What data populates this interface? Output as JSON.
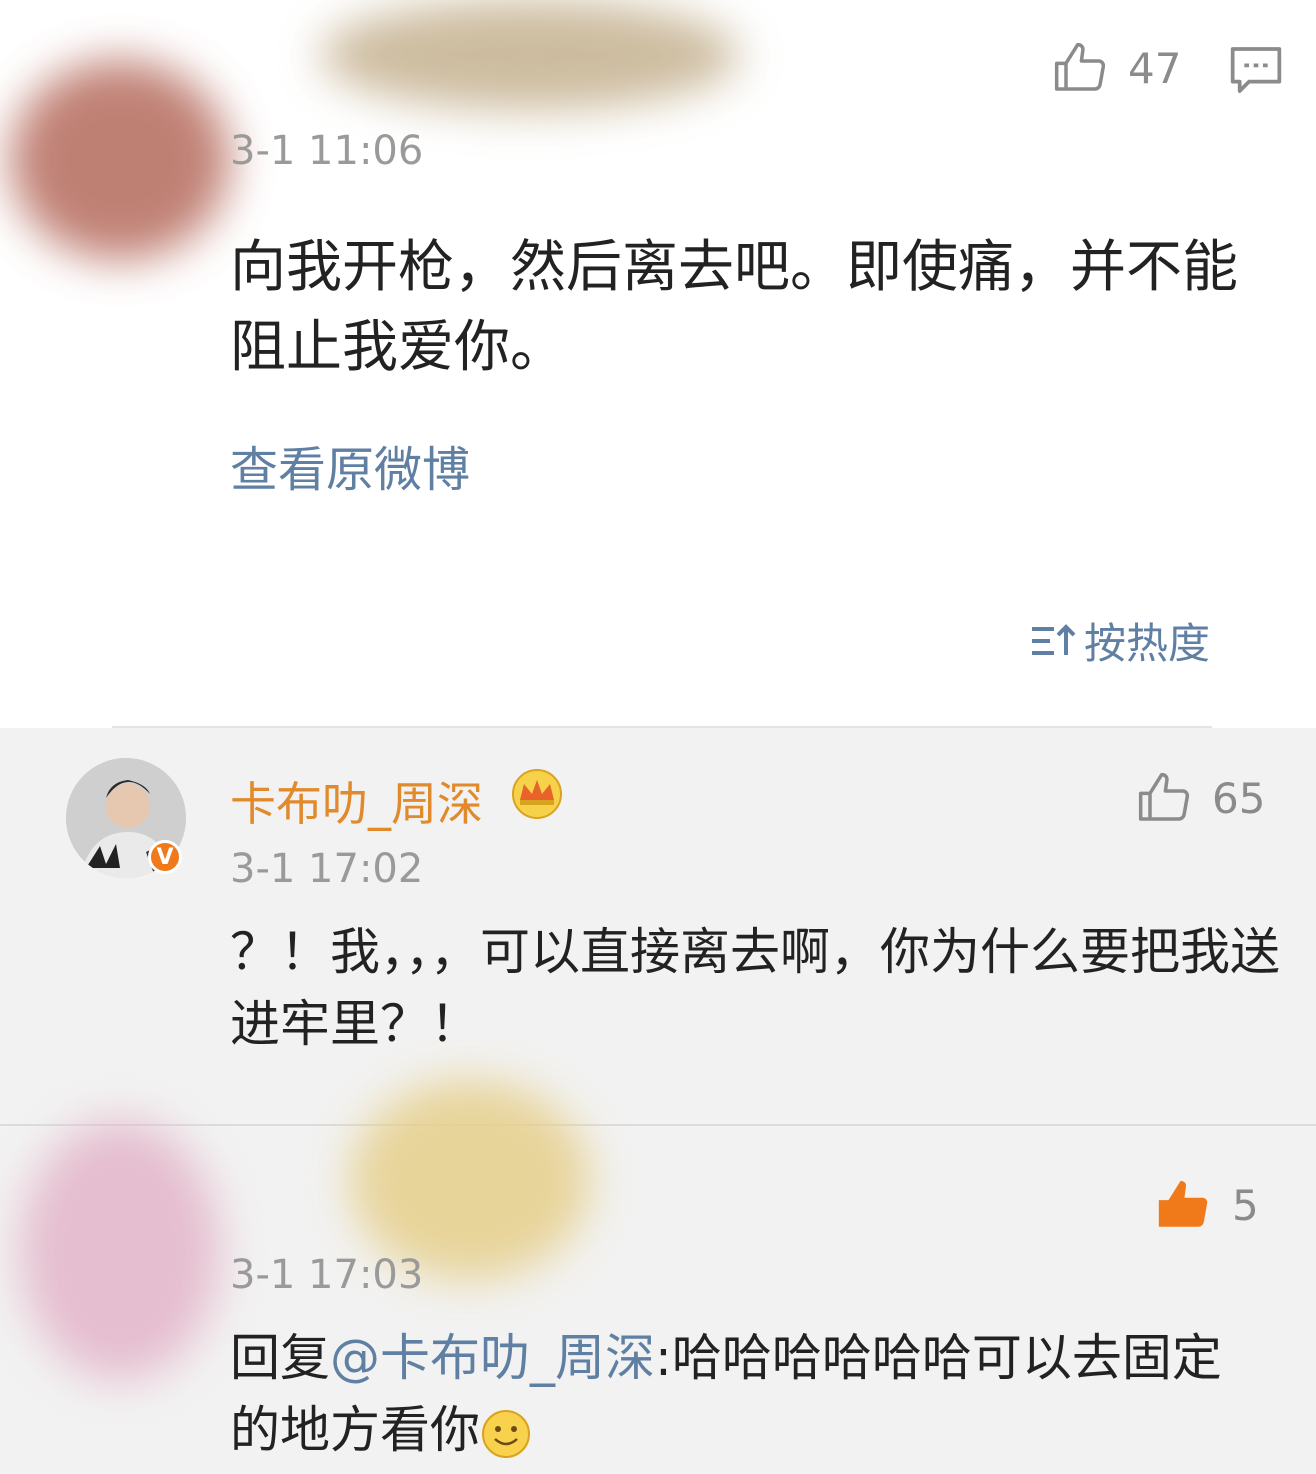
{
  "top_post": {
    "likes": "47",
    "timestamp": "3-1 11:06",
    "text": "向我开枪，然后离去吧。即使痛，并不能阻止我爱你。",
    "view_original": "查看原微博"
  },
  "sort": {
    "label": "按热度"
  },
  "comments": [
    {
      "username": "卡布叻_周深",
      "badge": "V",
      "likes": "65",
      "timestamp": "3-1 17:02",
      "text": "？！我，，，可以直接离去啊，你为什么要把我送进牢里？！"
    },
    {
      "likes": "5",
      "timestamp": "3-1 17:03",
      "reply_prefix": "回复",
      "mention": "@卡布叻_周深",
      "text": ":哈哈哈哈哈哈可以去固定的地方看你"
    }
  ],
  "colors": {
    "link": "#5f7fa3",
    "username": "#e08a2c",
    "liked": "#f07a1a",
    "comment_bg": "#f2f2f2"
  },
  "icons": [
    "thumbs-up-icon",
    "comment-icon",
    "sort-icon",
    "crown-icon",
    "verified-icon",
    "smile-emoji-icon"
  ]
}
